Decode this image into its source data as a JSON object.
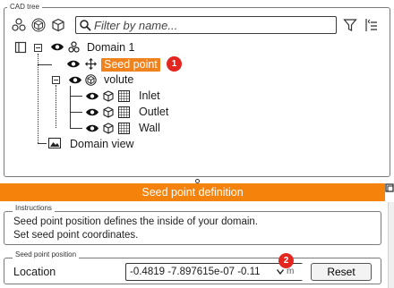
{
  "cad_tree": {
    "group_label": "CAD tree",
    "toolbar": {
      "icons": [
        "nodes-icon",
        "cube-outline-icon",
        "cube-icon"
      ],
      "search_placeholder": "Filter by name...",
      "filter_icon": "filter-icon",
      "list_icon": "list-icon"
    },
    "root": {
      "label": "Domain 1"
    },
    "seed_point": {
      "label": "Seed point",
      "badge": "1"
    },
    "volute": {
      "label": "volute",
      "children": [
        {
          "label": "Inlet"
        },
        {
          "label": "Outlet"
        },
        {
          "label": "Wall"
        }
      ]
    },
    "domain_view": {
      "label": "Domain view"
    }
  },
  "seed_point_definition": {
    "title": "Seed point definition",
    "instructions": {
      "group_label": "Instructions",
      "lines": [
        "Seed point position defines the inside of your domain.",
        "Set seed point coordinates."
      ]
    },
    "position": {
      "group_label": "Seed point position",
      "location_label": "Location",
      "location_value": "-0.4819 -7.897615e-07 -0.11",
      "unit": "m",
      "badge": "2",
      "reset_label": "Reset"
    }
  },
  "colors": {
    "accent_orange": "#f5820a",
    "selected_orange": "#f0821e",
    "badge_red": "#e3261f"
  }
}
